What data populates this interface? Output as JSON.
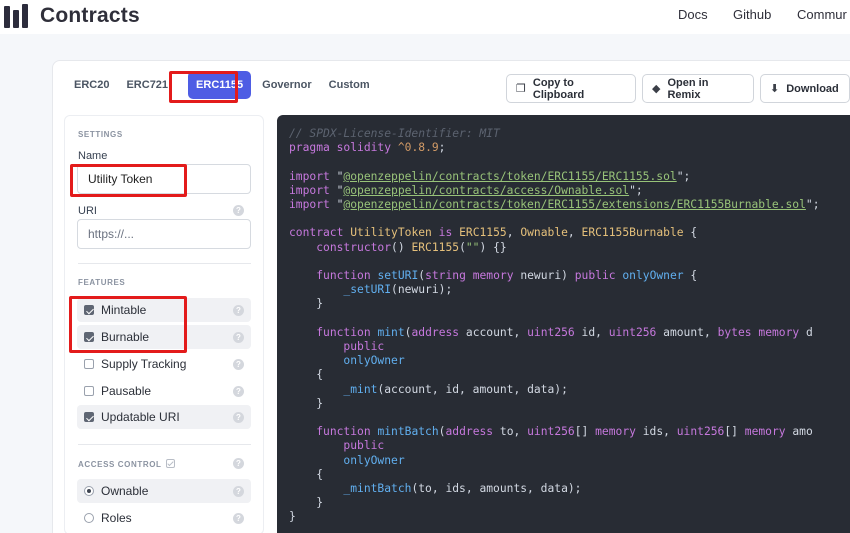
{
  "header": {
    "brand": "Contracts",
    "nav": [
      "Docs",
      "Github",
      "Commur"
    ]
  },
  "tabs": [
    {
      "label": "ERC20",
      "active": false
    },
    {
      "label": "ERC721",
      "active": false
    },
    {
      "label": "ERC1155",
      "active": true
    },
    {
      "label": "Governor",
      "active": false
    },
    {
      "label": "Custom",
      "active": false
    }
  ],
  "actions": {
    "copy": "Copy to Clipboard",
    "remix": "Open in Remix",
    "download": "Download"
  },
  "sidebar": {
    "settings_title": "SETTINGS",
    "name_label": "Name",
    "name_value": "Utility Token",
    "uri_label": "URI",
    "uri_placeholder": "https://...",
    "features_title": "FEATURES",
    "features": [
      {
        "label": "Mintable",
        "checked": true
      },
      {
        "label": "Burnable",
        "checked": true
      },
      {
        "label": "Supply Tracking",
        "checked": false
      },
      {
        "label": "Pausable",
        "checked": false
      },
      {
        "label": "Updatable URI",
        "checked": true
      }
    ],
    "access_title": "ACCESS CONTROL",
    "access": [
      {
        "label": "Ownable",
        "selected": true
      },
      {
        "label": "Roles",
        "selected": false
      }
    ],
    "help_glyph": "?"
  },
  "code": {
    "lines": [
      "// SPDX-License-Identifier: MIT",
      "pragma solidity ^0.8.9;",
      "",
      "import \"@openzeppelin/contracts/token/ERC1155/ERC1155.sol\";",
      "import \"@openzeppelin/contracts/access/Ownable.sol\";",
      "import \"@openzeppelin/contracts/token/ERC1155/extensions/ERC1155Burnable.sol\";",
      "",
      "contract UtilityToken is ERC1155, Ownable, ERC1155Burnable {",
      "    constructor() ERC1155(\"\") {}",
      "",
      "    function setURI(string memory newuri) public onlyOwner {",
      "        _setURI(newuri);",
      "    }",
      "",
      "    function mint(address account, uint256 id, uint256 amount, bytes memory d",
      "        public",
      "        onlyOwner",
      "    {",
      "        _mint(account, id, amount, data);",
      "    }",
      "",
      "    function mintBatch(address to, uint256[] memory ids, uint256[] memory amo",
      "        public",
      "        onlyOwner",
      "    {",
      "        _mintBatch(to, ids, amounts, data);",
      "    }",
      "}"
    ]
  },
  "colors": {
    "accent": "#4e5de4",
    "highlight": "#e31b1b",
    "code_bg": "#282c34"
  }
}
